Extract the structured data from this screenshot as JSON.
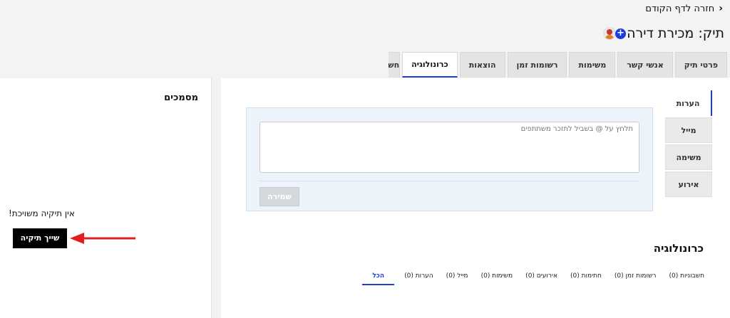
{
  "header": {
    "back_label": "חזרה לדף הקודם",
    "case_title": "תיק: מכירת דירה",
    "add_user_symbol": "+"
  },
  "tabs": [
    {
      "label": "פרטי תיק",
      "active": false
    },
    {
      "label": "אנשי קשר",
      "active": false
    },
    {
      "label": "משימות",
      "active": false
    },
    {
      "label": "רשומות זמן",
      "active": false
    },
    {
      "label": "הוצאות",
      "active": false
    },
    {
      "label": "כרונולוגיה",
      "active": true
    },
    {
      "label": "חשבו",
      "active": false
    }
  ],
  "documents": {
    "title": "מסמכים",
    "no_folder_text": "אין תיקיה משויכת!",
    "attach_button": "שייך תיקיה"
  },
  "side_tabs": [
    {
      "label": "הערות",
      "active": true
    },
    {
      "label": "מייל",
      "active": false
    },
    {
      "label": "משימה",
      "active": false
    },
    {
      "label": "אירוע",
      "active": false
    }
  ],
  "note": {
    "placeholder": "תלחץ על @ בשביל לתזכר משתתפים",
    "save_button": "שמירה"
  },
  "timeline": {
    "title": "כרונולוגיה",
    "filters": [
      {
        "label": "הכל",
        "active": true
      },
      {
        "label": "הערות (0)",
        "active": false
      },
      {
        "label": "מייל (0)",
        "active": false
      },
      {
        "label": "משימות (0)",
        "active": false
      },
      {
        "label": "אירועים (0)",
        "active": false
      },
      {
        "label": "חתימות (0)",
        "active": false
      },
      {
        "label": "רשומות זמן (0)",
        "active": false
      },
      {
        "label": "חשבוניות (0)",
        "active": false
      }
    ]
  },
  "colors": {
    "accent": "#1b3de0",
    "annotation_arrow": "#e02020"
  }
}
